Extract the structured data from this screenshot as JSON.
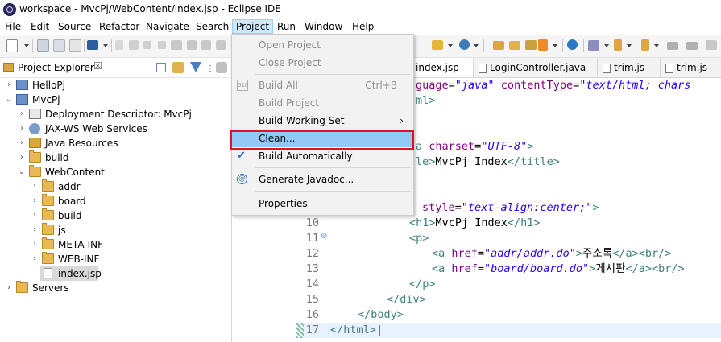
{
  "window": {
    "title": "workspace - MvcPj/WebContent/index.jsp - Eclipse IDE"
  },
  "menubar": {
    "items": [
      "File",
      "Edit",
      "Source",
      "Refactor",
      "Navigate",
      "Search",
      "Project",
      "Run",
      "Window",
      "Help"
    ],
    "active": "Project"
  },
  "project_menu": {
    "items": [
      {
        "label": "Open Project",
        "enabled": false
      },
      {
        "label": "Close Project",
        "enabled": false
      },
      {
        "label": "Build All",
        "shortcut": "Ctrl+B",
        "enabled": false
      },
      {
        "label": "Build Project",
        "enabled": false
      },
      {
        "label": "Build Working Set",
        "enabled": true,
        "submenu_arrow": "›"
      },
      {
        "label": "Clean...",
        "enabled": true,
        "highlighted": true
      },
      {
        "label": "Build Automatically",
        "enabled": true,
        "checked": true
      },
      {
        "label": "Generate Javadoc...",
        "enabled": true
      },
      {
        "label": "Properties",
        "enabled": true
      }
    ],
    "highlight_color": "#e0141e"
  },
  "explorer": {
    "title": "Project Explorer",
    "close": "☒",
    "tree": [
      {
        "label": "HelloPj",
        "kind": "project",
        "expanded": false
      },
      {
        "label": "MvcPj",
        "kind": "project",
        "expanded": true
      },
      {
        "label": "Deployment Descriptor: MvcPj",
        "kind": "descriptor",
        "expanded": false
      },
      {
        "label": "JAX-WS Web Services",
        "kind": "webservice",
        "expanded": false
      },
      {
        "label": "Java Resources",
        "kind": "java",
        "expanded": false
      },
      {
        "label": "build",
        "kind": "folder",
        "expanded": false
      },
      {
        "label": "WebContent",
        "kind": "folder",
        "expanded": true
      },
      {
        "label": "addr",
        "kind": "folder",
        "expanded": false
      },
      {
        "label": "board",
        "kind": "folder",
        "expanded": false
      },
      {
        "label": "build",
        "kind": "folder",
        "expanded": false
      },
      {
        "label": "js",
        "kind": "folder",
        "expanded": false
      },
      {
        "label": "META-INF",
        "kind": "folder",
        "expanded": false
      },
      {
        "label": "WEB-INF",
        "kind": "folder",
        "expanded": false
      },
      {
        "label": "index.jsp",
        "kind": "file",
        "selected": true
      },
      {
        "label": "Servers",
        "kind": "folder",
        "expanded": false
      }
    ]
  },
  "editor": {
    "tabs": [
      "index.jsp",
      "LoginController.java",
      "trim.js",
      "trim.js"
    ],
    "active_tab": "index.jsp",
    "visible_fragments": {
      "l1": "guage=\"java\" contentType=\"text/html; chars",
      "l2": "ml>",
      "l5": "a charset=\"UTF-8\">",
      "l6": "le>MvcPj Index</title>",
      "l9": "style=\"text-align:center;\">"
    },
    "lines": [
      {
        "n": "10",
        "text": "<h1>MvcPj Index</h1>"
      },
      {
        "n": "11",
        "text": "<p>",
        "fold": "⊖"
      },
      {
        "n": "12",
        "text": "<a href=\"addr/addr.do\">주소록</a><br/>"
      },
      {
        "n": "13",
        "text": "<a href=\"board/board.do\">게시판</a><br/>"
      },
      {
        "n": "14",
        "text": "</p>"
      },
      {
        "n": "15",
        "text": "</div>"
      },
      {
        "n": "16",
        "text": "</body>"
      },
      {
        "n": "17",
        "text": "</html>"
      }
    ]
  }
}
